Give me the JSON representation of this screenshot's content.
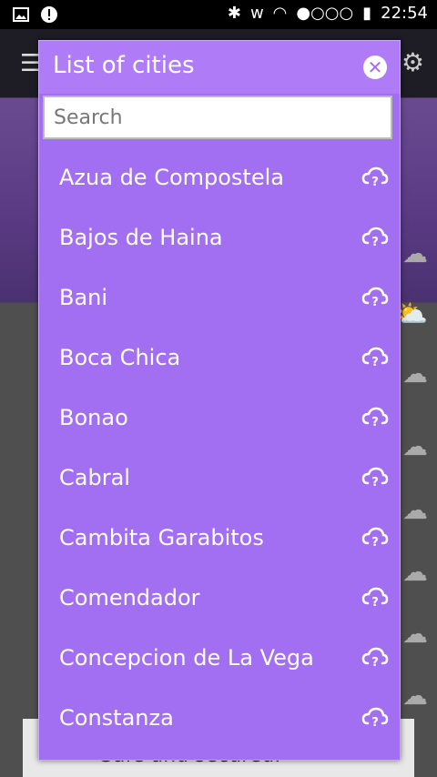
{
  "status_bar": {
    "time": "22:54",
    "icons": [
      "image-icon",
      "alert-icon",
      "bluetooth-icon",
      "signal-icon",
      "wifi-icon",
      "battery-icon"
    ]
  },
  "background": {
    "ad_text": "Safe and secured."
  },
  "dialog": {
    "title": "List of cities",
    "search_placeholder": "Search",
    "close_icon": "close-icon",
    "cities": [
      {
        "name": "Azua de Compostela"
      },
      {
        "name": "Bajos de Haina"
      },
      {
        "name": "Bani"
      },
      {
        "name": "Boca Chica"
      },
      {
        "name": "Bonao"
      },
      {
        "name": "Cabral"
      },
      {
        "name": "Cambita Garabitos"
      },
      {
        "name": "Comendador"
      },
      {
        "name": "Concepcion de La Vega"
      },
      {
        "name": "Constanza"
      }
    ],
    "item_icon": "cloud-question-icon"
  },
  "colors": {
    "dialog_bg": "#a26ef2",
    "header_bg": "#b07bf6",
    "text": "#ffffff"
  }
}
